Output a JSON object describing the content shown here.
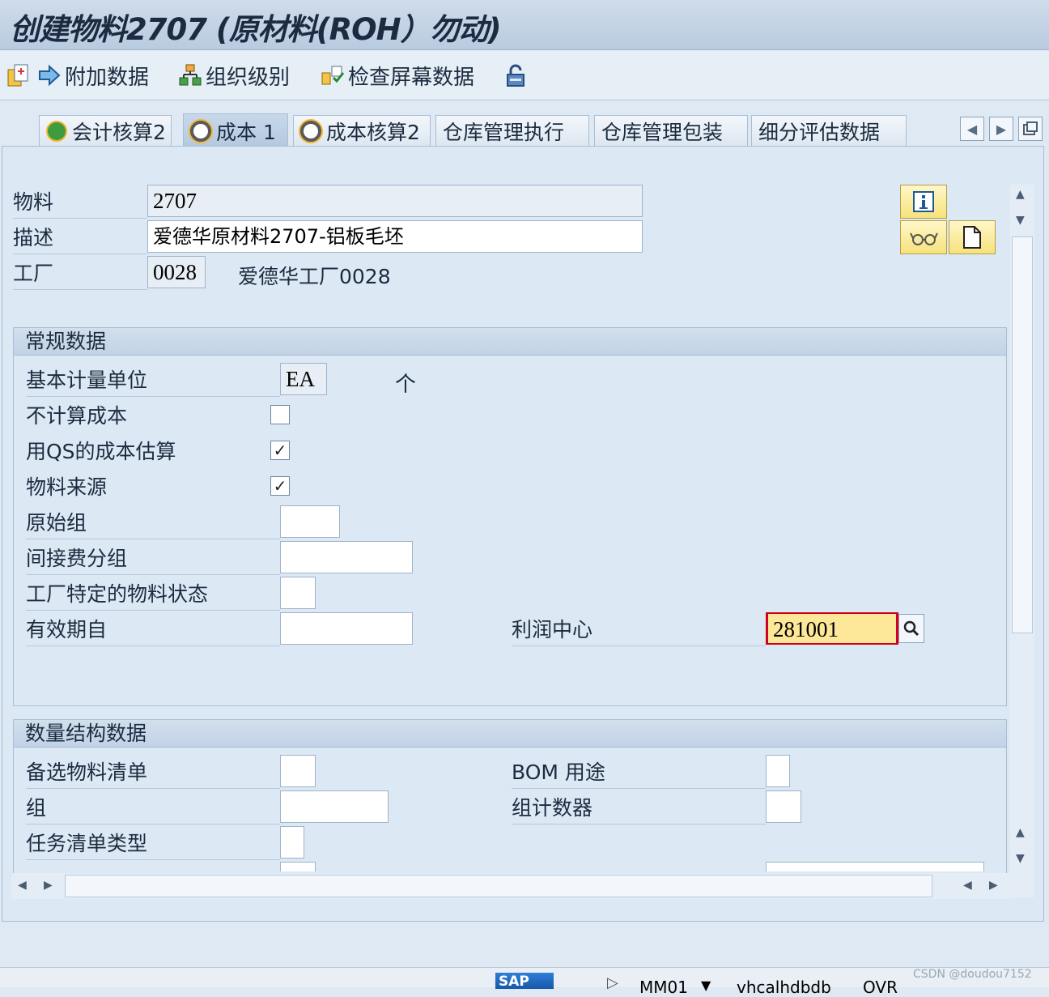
{
  "window": {
    "title": "创建物料2707 (原材料(ROH）勿动)"
  },
  "toolbar": {
    "items": [
      {
        "icon": "new-screen-icon",
        "label": ""
      },
      {
        "icon": "arrow-right-icon",
        "label": "附加数据"
      },
      {
        "icon": "org-levels-icon",
        "label": "组织级别"
      },
      {
        "icon": "check-screen-icon",
        "label": "检查屏幕数据"
      },
      {
        "icon": "lock-icon",
        "label": ""
      }
    ]
  },
  "tabs": [
    {
      "label": "会计核算2",
      "icon": "check-circle-icon"
    },
    {
      "label": "成本 1",
      "icon": "gear-icon",
      "active": true
    },
    {
      "label": "成本核算2",
      "icon": "gear-icon"
    },
    {
      "label": "仓库管理执行"
    },
    {
      "label": "仓库管理包装"
    },
    {
      "label": "细分评估数据"
    }
  ],
  "header": {
    "material_label": "物料",
    "material_value": "2707",
    "description_label": "描述",
    "description_value": "爱德华原材料2707-铝板毛坯",
    "plant_label": "工厂",
    "plant_value": "0028",
    "plant_text": "爱德华工厂0028"
  },
  "general": {
    "title": "常规数据",
    "base_uom_label": "基本计量单位",
    "base_uom_value": "EA",
    "base_uom_text": "个",
    "no_costing_label": "不计算成本",
    "no_costing_checked": false,
    "qs_costing_label": "用QS的成本估算",
    "qs_costing_checked": true,
    "material_origin_label": "物料来源",
    "material_origin_checked": true,
    "origin_group_label": "原始组",
    "origin_group_value": "",
    "overhead_group_label": "间接费分组",
    "overhead_group_value": "",
    "plant_status_label": "工厂特定的物料状态",
    "plant_status_value": "",
    "valid_from_label": "有效期自",
    "valid_from_value": "",
    "profit_center_label": "利润中心",
    "profit_center_value": "281001"
  },
  "quantity": {
    "title": "数量结构数据",
    "alt_bom_label": "备选物料清单",
    "alt_bom_value": "",
    "bom_usage_label": "BOM 用途",
    "bom_usage_value": "",
    "group_label": "组",
    "group_value": "",
    "group_counter_label": "组计数器",
    "group_counter_value": "",
    "task_list_type_label": "任务清单类型",
    "task_list_type_value": ""
  },
  "status_bar": {
    "transaction": "MM01",
    "server": "vhcalhdbdb",
    "mode": "OVR",
    "watermark": "CSDN @doudou7152"
  },
  "colors": {
    "required_field_bg": "#fde899",
    "required_marker": "#d0021b"
  }
}
